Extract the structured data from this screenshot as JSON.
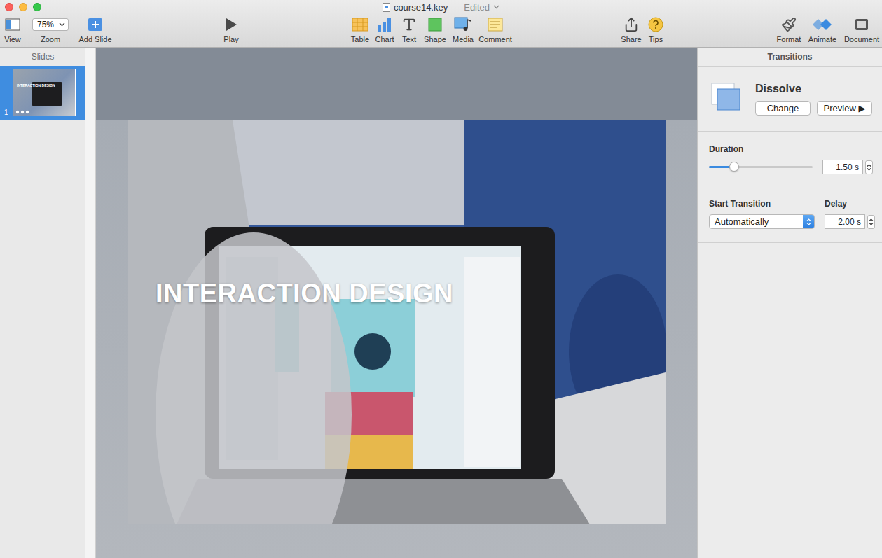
{
  "window": {
    "title": "course14.key",
    "separator": "—",
    "status": "Edited"
  },
  "toolbar": {
    "left": [
      {
        "label": "View",
        "kind": "button"
      },
      {
        "label": "Zoom",
        "kind": "dropdown",
        "value": "75%"
      },
      {
        "label": "Add Slide",
        "kind": "button"
      }
    ],
    "center": [
      {
        "label": "Play"
      }
    ],
    "insert": [
      {
        "label": "Table"
      },
      {
        "label": "Chart"
      },
      {
        "label": "Text"
      },
      {
        "label": "Shape"
      },
      {
        "label": "Media"
      },
      {
        "label": "Comment"
      }
    ],
    "share": [
      {
        "label": "Share"
      },
      {
        "label": "Tips"
      }
    ],
    "right": [
      {
        "label": "Format",
        "selected": false
      },
      {
        "label": "Animate",
        "selected": true
      },
      {
        "label": "Document",
        "selected": false
      }
    ]
  },
  "sidebar": {
    "title": "Slides",
    "slides": [
      {
        "number": "1",
        "title": "INTERACTION DESIGN",
        "selected": true
      }
    ]
  },
  "slide": {
    "title": "INTERACTION DESIGN"
  },
  "inspector": {
    "title": "Transitions",
    "effect": {
      "name": "Dissolve",
      "buttons": [
        "Change",
        "Preview ▶"
      ]
    },
    "duration": {
      "label": "Duration",
      "level": 0.24,
      "value": "1.50 s"
    },
    "start": {
      "label": "Start Transition",
      "value": "Automatically"
    },
    "delay": {
      "label": "Delay",
      "value": "2.00 s"
    }
  }
}
